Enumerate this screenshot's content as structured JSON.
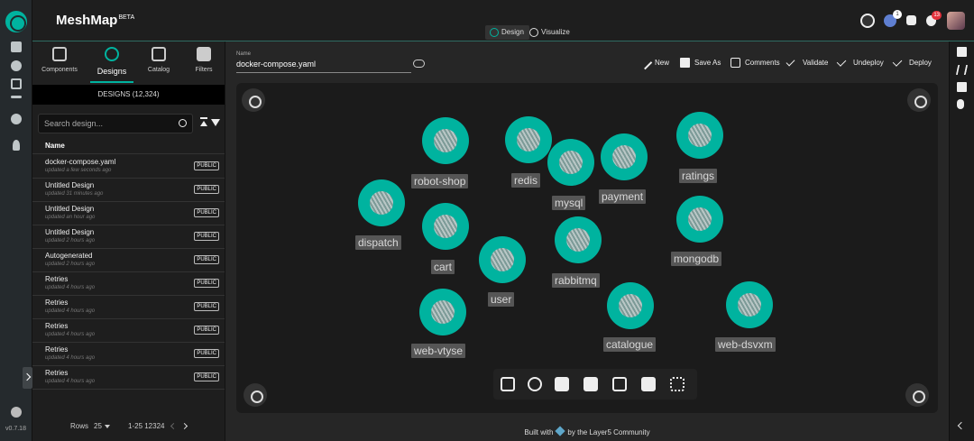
{
  "app": {
    "brand": "MeshMap",
    "brand_sup": "BETA",
    "version": "v0.7.18"
  },
  "topbar": {
    "modes": [
      {
        "label": "Design",
        "active": true
      },
      {
        "label": "Visualize",
        "active": false
      }
    ],
    "badges": {
      "providers": "1",
      "notifications": "13"
    }
  },
  "catalog": {
    "tabs": [
      {
        "label": "Components",
        "icon": "components-icon"
      },
      {
        "label": "Designs",
        "icon": "designs-icon",
        "active": true
      },
      {
        "label": "Catalog",
        "icon": "catalog-icon"
      },
      {
        "label": "Filters",
        "icon": "filters-icon"
      }
    ],
    "header": "DESIGNS (12,324)",
    "search_placeholder": "Search design...",
    "column_name": "Name",
    "rows": [
      {
        "name": "docker-compose.yaml",
        "updated": "updated a few seconds ago",
        "badge": "PUBLIC"
      },
      {
        "name": "Untitled Design",
        "updated": "updated 31 minutes ago",
        "badge": "PUBLIC"
      },
      {
        "name": "Untitled Design",
        "updated": "updated an hour ago",
        "badge": "PUBLIC"
      },
      {
        "name": "Untitled Design",
        "updated": "updated 2 hours ago",
        "badge": "PUBLIC"
      },
      {
        "name": "Autogenerated",
        "updated": "updated 2 hours ago",
        "badge": "PUBLIC"
      },
      {
        "name": "Retries",
        "updated": "updated 4 hours ago",
        "badge": "PUBLIC"
      },
      {
        "name": "Retries",
        "updated": "updated 4 hours ago",
        "badge": "PUBLIC"
      },
      {
        "name": "Retries",
        "updated": "updated 4 hours ago",
        "badge": "PUBLIC"
      },
      {
        "name": "Retries",
        "updated": "updated 4 hours ago",
        "badge": "PUBLIC"
      },
      {
        "name": "Retries",
        "updated": "updated 4 hours ago",
        "badge": "PUBLIC"
      }
    ],
    "pager": {
      "rows_label": "Rows",
      "rows_value": "25",
      "range": "1-25 12324"
    }
  },
  "design": {
    "name_label": "Name",
    "name_value": "docker-compose.yaml",
    "actions": [
      "New",
      "Save As",
      "Comments",
      "Validate",
      "Undeploy",
      "Deploy"
    ]
  },
  "nodes": [
    {
      "label": "robot-shop"
    },
    {
      "label": "redis"
    },
    {
      "label": "mysql"
    },
    {
      "label": "payment"
    },
    {
      "label": "ratings"
    },
    {
      "label": "dispatch"
    },
    {
      "label": "cart"
    },
    {
      "label": "rabbitmq"
    },
    {
      "label": "mongodb"
    },
    {
      "label": "user"
    },
    {
      "label": "catalogue"
    },
    {
      "label": "web-vtyse"
    },
    {
      "label": "web-dsvxm"
    }
  ],
  "footer": {
    "left": "Built with",
    "right": "by the Layer5 Community"
  },
  "colors": {
    "accent": "#00b39f",
    "badge": "#e3323d"
  }
}
